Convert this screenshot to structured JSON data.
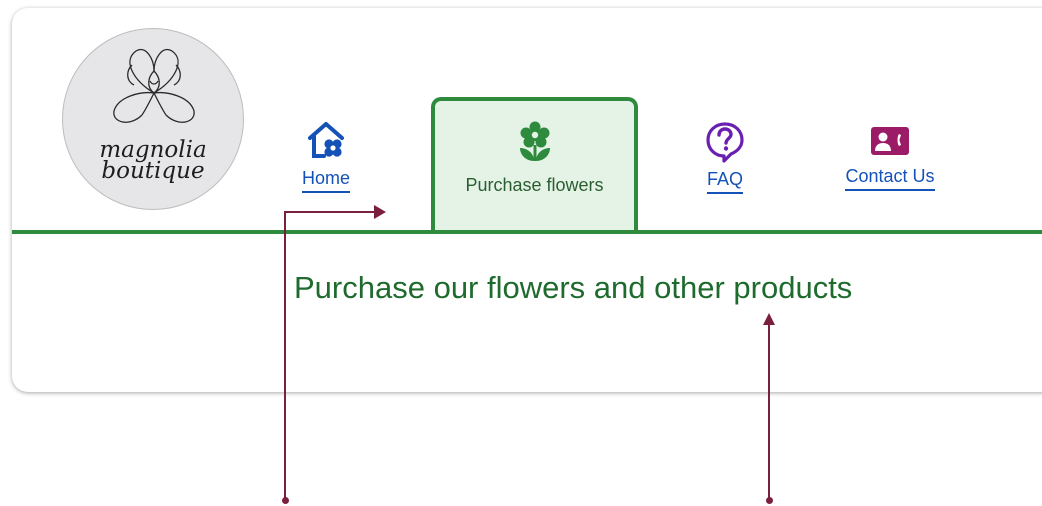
{
  "logo": {
    "line1": "magnolia",
    "line2": "boutique"
  },
  "nav": {
    "items": [
      {
        "label": "Home",
        "icon": "home-flower-icon",
        "color": "#1452b8"
      },
      {
        "label": "Purchase flowers",
        "icon": "flower-icon",
        "color": "#2e8b3d",
        "active": true
      },
      {
        "label": "FAQ",
        "icon": "question-bubble-icon",
        "color": "#6a1fb0"
      },
      {
        "label": "Contact Us",
        "icon": "contact-card-icon",
        "color": "#9b1b67"
      }
    ]
  },
  "main": {
    "heading": "Purchase our flowers and other products"
  },
  "colors": {
    "accent_green": "#2e8b3d",
    "heading_green": "#1f6b2e",
    "link_blue": "#1452b8",
    "annotation": "#7a1f3d"
  }
}
